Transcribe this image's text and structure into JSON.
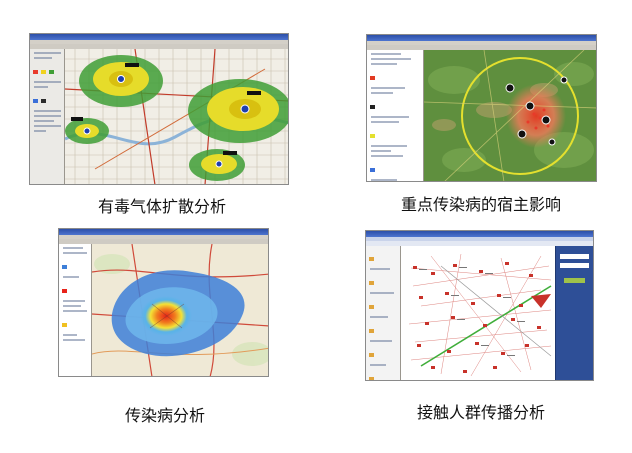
{
  "panels": [
    {
      "caption": "有毒气体扩散分析"
    },
    {
      "caption": "重点传染病的宿主影响"
    },
    {
      "caption": "传染病分析"
    },
    {
      "caption": "接触人群传播分析"
    }
  ],
  "colors": {
    "plume_outer": "#3f9e35",
    "plume_mid": "#e6dc2a",
    "plume_core": "#d8c010",
    "terrain_green": "#5f8f3e",
    "buffer_ring": "#e4e02e",
    "hotspot_red": "#e23a22",
    "density_blue": "#3d7fd8",
    "density_core": "#e8231a",
    "network_bg": "#ffffff",
    "network_nodes": "#c8322a"
  }
}
